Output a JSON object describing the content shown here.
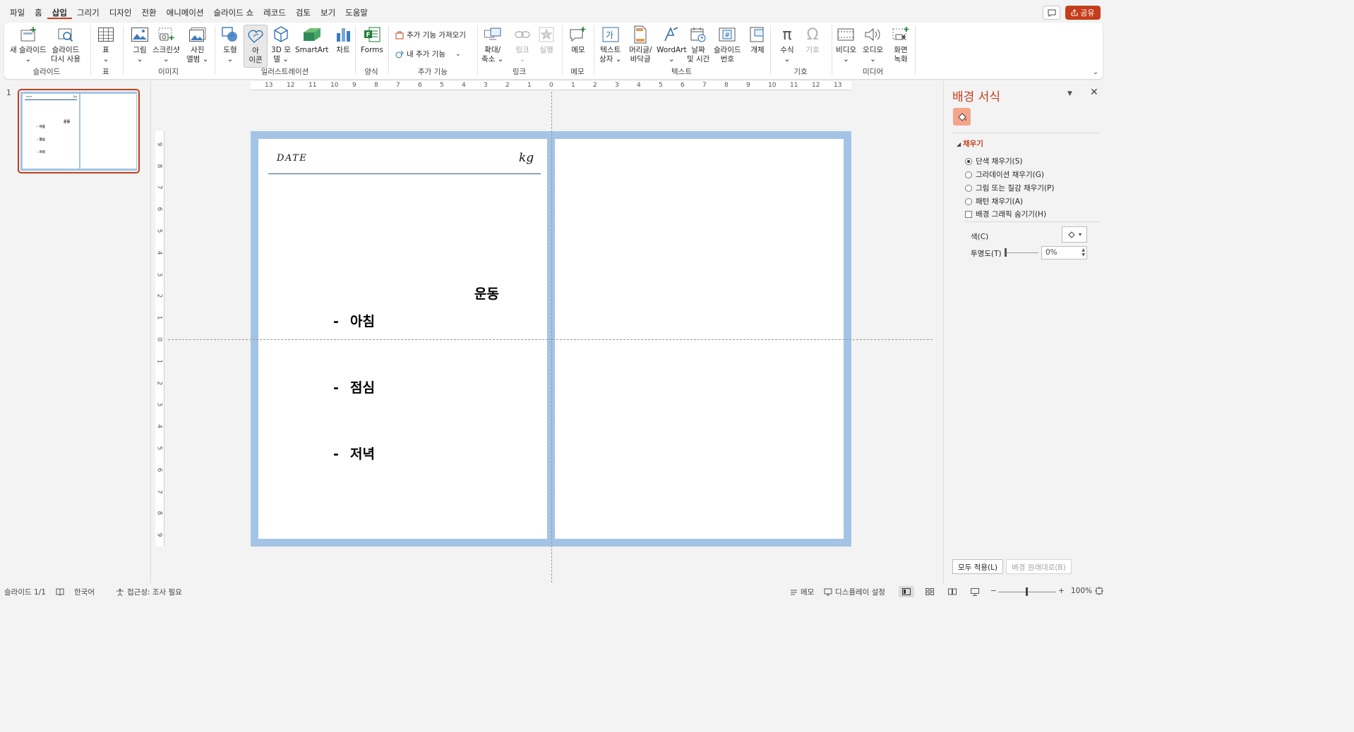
{
  "menu": {
    "tabs": [
      "파일",
      "홈",
      "삽입",
      "그리기",
      "디자인",
      "전환",
      "애니메이션",
      "슬라이드 쇼",
      "레코드",
      "검토",
      "보기",
      "도움말"
    ],
    "active_tab": "삽입",
    "share_label": "공유"
  },
  "ribbon": {
    "groups": {
      "slides": "슬라이드",
      "table": "표",
      "images": "이미지",
      "illustrations": "일러스트레이션",
      "forms": "양식",
      "addins": "추가 기능",
      "links": "링크",
      "comments": "메모",
      "text": "텍스트",
      "symbols": "기호",
      "media": "미디어"
    },
    "buttons": {
      "new_slide": [
        "새 슬라이드",
        "⌄"
      ],
      "reuse_slides": [
        "슬라이드",
        "다시 사용"
      ],
      "table": [
        "표",
        "⌄"
      ],
      "pictures": [
        "그림",
        "⌄"
      ],
      "screenshot": [
        "스크린샷",
        "⌄"
      ],
      "photo_album": [
        "사진",
        "앨범 ⌄"
      ],
      "shapes": [
        "도형",
        "⌄"
      ],
      "icons": [
        "아",
        "이콘"
      ],
      "models_3d": [
        "3D 모",
        "델 ⌄"
      ],
      "smartart": [
        "SmartArt"
      ],
      "chart": [
        "차트"
      ],
      "forms": [
        "Forms"
      ],
      "get_addins": "추가 기능 가져오기",
      "my_addins": "내 추가 기능",
      "zoom": [
        "확대/",
        "축소 ⌄"
      ],
      "link": [
        "링크",
        "⌄"
      ],
      "action": [
        "실행"
      ],
      "comment": [
        "메모"
      ],
      "text_box": [
        "텍스트",
        "상자 ⌄"
      ],
      "header_footer": [
        "머리글/",
        "바닥글"
      ],
      "wordart": [
        "WordArt",
        "⌄"
      ],
      "date_time": [
        "날짜",
        "및 시간"
      ],
      "slide_number": [
        "슬라이드",
        "번호"
      ],
      "object": [
        "개체"
      ],
      "equation": [
        "수식",
        "⌄"
      ],
      "symbol": [
        "기호"
      ],
      "video": [
        "비디오",
        "⌄"
      ],
      "audio": [
        "오디오",
        "⌄"
      ],
      "screen_recording": [
        "화면",
        "녹화"
      ]
    }
  },
  "thumbnails": {
    "number": "1",
    "mini": {
      "date": "DATE",
      "kg": "kg",
      "title": "운동",
      "meals": [
        "아침",
        "점심",
        "저녁"
      ]
    }
  },
  "rulers": {
    "horizontal": [
      "13",
      "12",
      "11",
      "10",
      "9",
      "8",
      "7",
      "6",
      "5",
      "4",
      "3",
      "2",
      "1",
      "0",
      "1",
      "2",
      "3",
      "4",
      "5",
      "6",
      "7",
      "8",
      "9",
      "10",
      "11",
      "12",
      "13"
    ],
    "vertical": [
      "9",
      "8",
      "7",
      "6",
      "5",
      "4",
      "3",
      "2",
      "1",
      "0",
      "1",
      "2",
      "3",
      "4",
      "5",
      "6",
      "7",
      "8",
      "9"
    ]
  },
  "slide": {
    "date_label": "DATE",
    "kg_label": "kg",
    "section_title": "운동",
    "meals": [
      {
        "dash": "-",
        "label": "아침"
      },
      {
        "dash": "-",
        "label": "점심"
      },
      {
        "dash": "-",
        "label": "저녁"
      }
    ],
    "border_color": "#a3c4e6"
  },
  "format_pane": {
    "title": "배경 서식",
    "section": "채우기",
    "options": [
      {
        "label": "단색 채우기(S)",
        "checked": true
      },
      {
        "label": "그라데이션 채우기(G)",
        "checked": false
      },
      {
        "label": "그림 또는 질감 채우기(P)",
        "checked": false
      },
      {
        "label": "패턴 채우기(A)",
        "checked": false
      }
    ],
    "hide_graphics_label": "배경 그래픽 숨기기(H)",
    "color_label": "색(C)",
    "transparency_label": "투명도(T)",
    "transparency_value": "0%",
    "apply_all": "모두 적용(L)",
    "reset_background": "배경 원래대로(B)"
  },
  "statusbar": {
    "slide_counter": "슬라이드 1/1",
    "language": "한국어",
    "accessibility": "접근성: 조사 필요",
    "notes": "메모",
    "display_settings": "디스플레이 설정",
    "zoom_minus": "−",
    "zoom_plus": "+",
    "zoom_level": "100%"
  },
  "colors": {
    "accent": "#c43e1c",
    "slide_border": "#a3c4e6"
  }
}
